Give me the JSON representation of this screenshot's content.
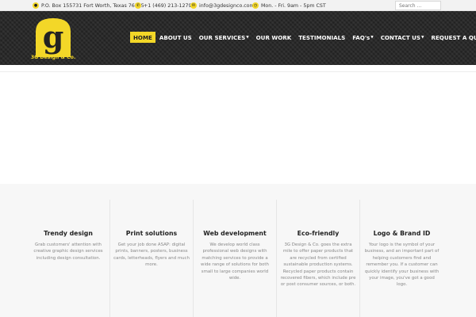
{
  "topbar": {
    "address": "P.O. Box 155731 Fort Worth, Texas 76155",
    "phone": "+1 (469) 213-1279",
    "email": "info@3gdesignco.com",
    "hours": "Mon. - Fri. 9am - 5pm CST",
    "search_placeholder": "Search ...",
    "icons": [
      "map-marker-icon",
      "phone-icon",
      "envelope-icon",
      "clock-icon"
    ]
  },
  "logo": {
    "letter": "g",
    "tagline": "3G Design & Co."
  },
  "nav": {
    "items": [
      {
        "label": "HOME",
        "active": true,
        "dropdown": false
      },
      {
        "label": "ABOUT US",
        "active": false,
        "dropdown": false
      },
      {
        "label": "OUR SERVICES",
        "active": false,
        "dropdown": true
      },
      {
        "label": "OUR WORK",
        "active": false,
        "dropdown": false
      },
      {
        "label": "TESTIMONIALS",
        "active": false,
        "dropdown": false
      },
      {
        "label": "FAQ's",
        "active": false,
        "dropdown": true
      },
      {
        "label": "CONTACT US",
        "active": false,
        "dropdown": true
      },
      {
        "label": "REQUEST A QUOTE",
        "active": false,
        "dropdown": false
      }
    ],
    "caret": "▼"
  },
  "services": [
    {
      "title": "Trendy design",
      "text": "Grab customers' attention with creative graphic design services including design consultation."
    },
    {
      "title": "Print solutions",
      "text": "Get your job done ASAP: digital prints, banners, posters, business cards, letterheads, flyers and much more."
    },
    {
      "title": "Web development",
      "text": "We develop world class professional web designs with matching services to provide a wide range of solutions for both small to large companies world wide."
    },
    {
      "title": "Eco-friendly",
      "text": "3G Design & Co. goes the extra mile to offer paper products that are recycled from certified sustainable production systems. Recycled paper products contain recovered fibers, which include pre or post consumer sources, or both."
    },
    {
      "title": "Logo & Brand ID",
      "text": "Your logo is the symbol of your business, and an important part of helping customers find and remember you. If a customer can quickly identify your business with your image, you've got a good logo."
    }
  ],
  "colors": {
    "accent": "#f3d728",
    "header_bg": "#2a2a2a",
    "text_muted": "#888888"
  }
}
